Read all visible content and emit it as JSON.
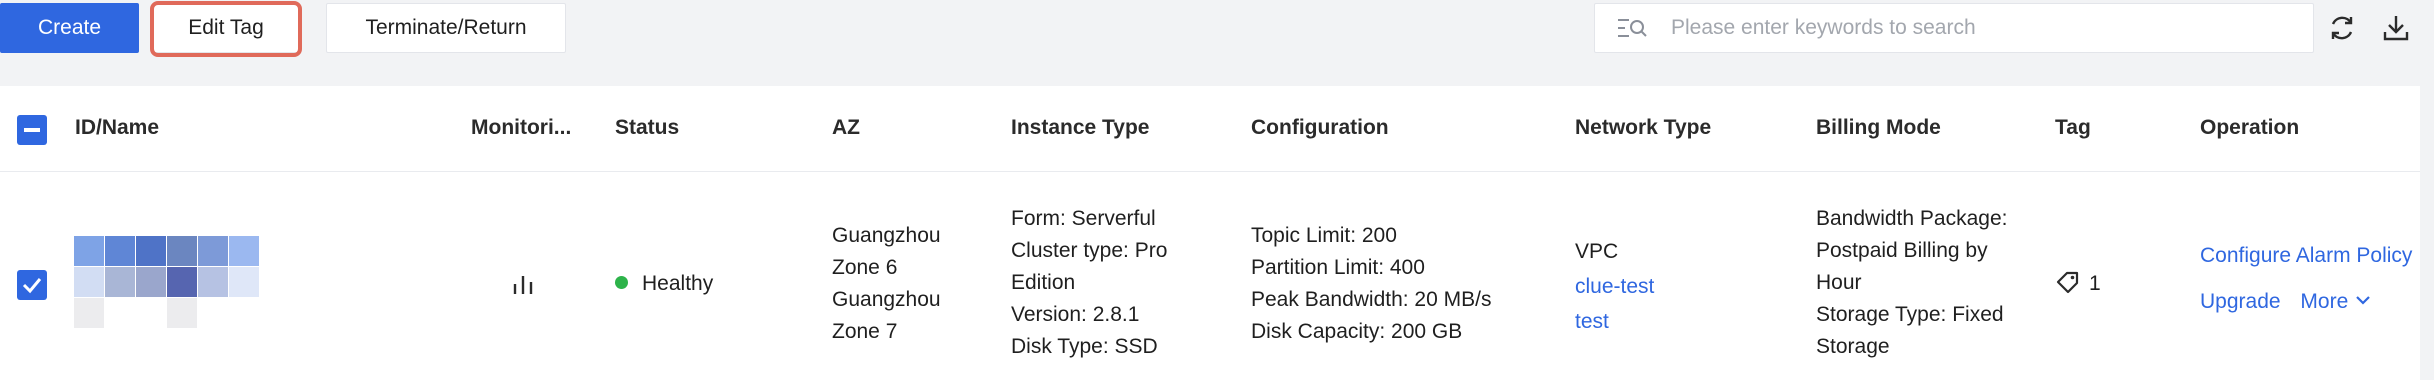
{
  "toolbar": {
    "create_label": "Create",
    "edit_tag_label": "Edit Tag",
    "terminate_label": "Terminate/Return",
    "search_placeholder": "Please enter keywords to search"
  },
  "colors": {
    "primary": "#2f67e0",
    "highlight_border": "#e06a5a",
    "healthy": "#2db34a"
  },
  "table": {
    "columns": [
      "ID/Name",
      "Monitori...",
      "Status",
      "AZ",
      "Instance Type",
      "Configuration",
      "Network Type",
      "Billing Mode",
      "Tag",
      "Operation"
    ],
    "rows": [
      {
        "selected": true,
        "status": "Healthy",
        "az": [
          "Guangzhou",
          "Zone 6",
          "Guangzhou",
          "Zone 7"
        ],
        "instance_type": [
          "Form: Serverful",
          "Cluster type: Pro",
          "Edition",
          "Version: 2.8.1",
          "Disk Type: SSD"
        ],
        "configuration": [
          "Topic Limit: 200",
          "Partition Limit: 400",
          "Peak Bandwidth: 20 MB/s",
          "Disk Capacity: 200 GB"
        ],
        "network": {
          "type": "VPC",
          "vpc_link": "clue-test",
          "subnet_link": "test"
        },
        "billing": [
          "Bandwidth Package:",
          "Postpaid Billing by",
          "Hour",
          "Storage Type: Fixed",
          "Storage"
        ],
        "tag_count": "1",
        "operations": {
          "configure_alarm": "Configure Alarm Policy",
          "upgrade": "Upgrade",
          "more": "More"
        }
      }
    ]
  }
}
